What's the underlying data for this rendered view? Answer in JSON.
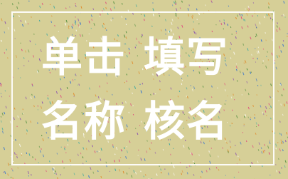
{
  "title_lines": [
    {
      "left": "单击",
      "right": "填写"
    },
    {
      "left": "名称",
      "right": "核名"
    }
  ],
  "colors": {
    "background": "#d6cf97",
    "text": "#ffffff",
    "frame": "#ffffff",
    "speckles": [
      "#e0457b",
      "#4a8a3a",
      "#2f6fcf",
      "#ffffff",
      "#8a4fb0",
      "#e08a2a",
      "#3fa8a0"
    ]
  }
}
